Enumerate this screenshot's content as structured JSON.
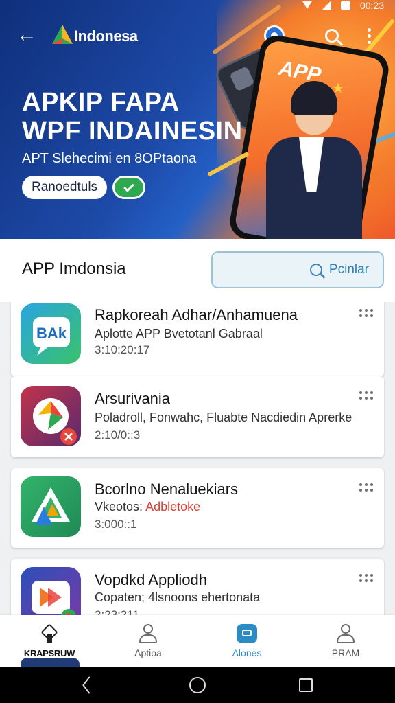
{
  "status_bar": {
    "time": "00:23"
  },
  "header": {
    "brand": "Indonesa",
    "hero_title_line1": "APKIP FAPA",
    "hero_title_line2": "WPF INDAINESIN",
    "hero_subtitle": "APT Slehecimi en 8OPtaona",
    "hero_button": "Ranoedtuls",
    "phone_screen_text": "APP"
  },
  "section": {
    "title": "APP Imdonsia",
    "popular_button": "Pcinlar"
  },
  "apps": [
    {
      "name": "Rapkoreah Adhar/Anhamuena",
      "desc": "Aplotte APP Bvetotanl Gabraal",
      "desc_highlight": "",
      "meta": "3:10:20:17",
      "icon": "chat-bubble-icon",
      "icon_text": "BAk"
    },
    {
      "name": "Arsurivania",
      "desc": "Poladroll, Fonwahc, Fluabte Nacdiedin Aprerke",
      "desc_highlight": "",
      "meta": "2:10/0::3",
      "icon": "compass-icon",
      "icon_text": ""
    },
    {
      "name": "Bcorlno Nenaluekiars",
      "desc": "Vkeotos: ",
      "desc_highlight": "Adbletoke",
      "meta": "3:000::1",
      "icon": "drive-triangle-icon",
      "icon_text": ""
    },
    {
      "name": "Vopdkd Appliodh",
      "desc": "Copaten; 4lsnoons ehertonata",
      "desc_highlight": "",
      "meta": "2:23:211",
      "icon": "media-play-icon",
      "icon_text": ""
    }
  ],
  "bottom_nav": [
    {
      "label": "KRAPSRUW",
      "icon": "apps-home-icon",
      "active": false
    },
    {
      "label": "Aptioa",
      "icon": "user-icon",
      "active": false
    },
    {
      "label": "Alones",
      "icon": "store-icon",
      "active": true
    },
    {
      "label": "PRAM",
      "icon": "profile-icon",
      "active": false
    }
  ],
  "colors": {
    "hero_blue": "#1d4aa8",
    "hero_orange": "#f07a2c",
    "accent": "#2b8cc4",
    "success": "#2fa84f",
    "highlight_red": "#e03c2f"
  }
}
